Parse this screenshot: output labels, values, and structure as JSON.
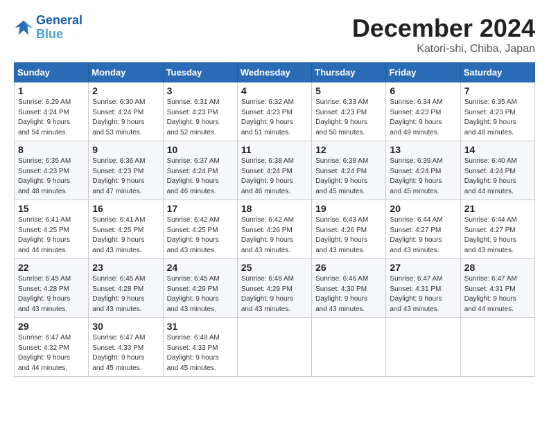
{
  "header": {
    "logo_line1": "General",
    "logo_line2": "Blue",
    "month_year": "December 2024",
    "location": "Katori-shi, Chiba, Japan"
  },
  "weekdays": [
    "Sunday",
    "Monday",
    "Tuesday",
    "Wednesday",
    "Thursday",
    "Friday",
    "Saturday"
  ],
  "weeks": [
    [
      {
        "day": "1",
        "info": "Sunrise: 6:29 AM\nSunset: 4:24 PM\nDaylight: 9 hours\nand 54 minutes."
      },
      {
        "day": "2",
        "info": "Sunrise: 6:30 AM\nSunset: 4:24 PM\nDaylight: 9 hours\nand 53 minutes."
      },
      {
        "day": "3",
        "info": "Sunrise: 6:31 AM\nSunset: 4:23 PM\nDaylight: 9 hours\nand 52 minutes."
      },
      {
        "day": "4",
        "info": "Sunrise: 6:32 AM\nSunset: 4:23 PM\nDaylight: 9 hours\nand 51 minutes."
      },
      {
        "day": "5",
        "info": "Sunrise: 6:33 AM\nSunset: 4:23 PM\nDaylight: 9 hours\nand 50 minutes."
      },
      {
        "day": "6",
        "info": "Sunrise: 6:34 AM\nSunset: 4:23 PM\nDaylight: 9 hours\nand 49 minutes."
      },
      {
        "day": "7",
        "info": "Sunrise: 6:35 AM\nSunset: 4:23 PM\nDaylight: 9 hours\nand 48 minutes."
      }
    ],
    [
      {
        "day": "8",
        "info": "Sunrise: 6:35 AM\nSunset: 4:23 PM\nDaylight: 9 hours\nand 48 minutes."
      },
      {
        "day": "9",
        "info": "Sunrise: 6:36 AM\nSunset: 4:23 PM\nDaylight: 9 hours\nand 47 minutes."
      },
      {
        "day": "10",
        "info": "Sunrise: 6:37 AM\nSunset: 4:24 PM\nDaylight: 9 hours\nand 46 minutes."
      },
      {
        "day": "11",
        "info": "Sunrise: 6:38 AM\nSunset: 4:24 PM\nDaylight: 9 hours\nand 46 minutes."
      },
      {
        "day": "12",
        "info": "Sunrise: 6:38 AM\nSunset: 4:24 PM\nDaylight: 9 hours\nand 45 minutes."
      },
      {
        "day": "13",
        "info": "Sunrise: 6:39 AM\nSunset: 4:24 PM\nDaylight: 9 hours\nand 45 minutes."
      },
      {
        "day": "14",
        "info": "Sunrise: 6:40 AM\nSunset: 4:24 PM\nDaylight: 9 hours\nand 44 minutes."
      }
    ],
    [
      {
        "day": "15",
        "info": "Sunrise: 6:41 AM\nSunset: 4:25 PM\nDaylight: 9 hours\nand 44 minutes."
      },
      {
        "day": "16",
        "info": "Sunrise: 6:41 AM\nSunset: 4:25 PM\nDaylight: 9 hours\nand 43 minutes."
      },
      {
        "day": "17",
        "info": "Sunrise: 6:42 AM\nSunset: 4:25 PM\nDaylight: 9 hours\nand 43 minutes."
      },
      {
        "day": "18",
        "info": "Sunrise: 6:42 AM\nSunset: 4:26 PM\nDaylight: 9 hours\nand 43 minutes."
      },
      {
        "day": "19",
        "info": "Sunrise: 6:43 AM\nSunset: 4:26 PM\nDaylight: 9 hours\nand 43 minutes."
      },
      {
        "day": "20",
        "info": "Sunrise: 6:44 AM\nSunset: 4:27 PM\nDaylight: 9 hours\nand 43 minutes."
      },
      {
        "day": "21",
        "info": "Sunrise: 6:44 AM\nSunset: 4:27 PM\nDaylight: 9 hours\nand 43 minutes."
      }
    ],
    [
      {
        "day": "22",
        "info": "Sunrise: 6:45 AM\nSunset: 4:28 PM\nDaylight: 9 hours\nand 43 minutes."
      },
      {
        "day": "23",
        "info": "Sunrise: 6:45 AM\nSunset: 4:28 PM\nDaylight: 9 hours\nand 43 minutes."
      },
      {
        "day": "24",
        "info": "Sunrise: 6:45 AM\nSunset: 4:29 PM\nDaylight: 9 hours\nand 43 minutes."
      },
      {
        "day": "25",
        "info": "Sunrise: 6:46 AM\nSunset: 4:29 PM\nDaylight: 9 hours\nand 43 minutes."
      },
      {
        "day": "26",
        "info": "Sunrise: 6:46 AM\nSunset: 4:30 PM\nDaylight: 9 hours\nand 43 minutes."
      },
      {
        "day": "27",
        "info": "Sunrise: 6:47 AM\nSunset: 4:31 PM\nDaylight: 9 hours\nand 43 minutes."
      },
      {
        "day": "28",
        "info": "Sunrise: 6:47 AM\nSunset: 4:31 PM\nDaylight: 9 hours\nand 44 minutes."
      }
    ],
    [
      {
        "day": "29",
        "info": "Sunrise: 6:47 AM\nSunset: 4:32 PM\nDaylight: 9 hours\nand 44 minutes."
      },
      {
        "day": "30",
        "info": "Sunrise: 6:47 AM\nSunset: 4:33 PM\nDaylight: 9 hours\nand 45 minutes."
      },
      {
        "day": "31",
        "info": "Sunrise: 6:48 AM\nSunset: 4:33 PM\nDaylight: 9 hours\nand 45 minutes."
      },
      null,
      null,
      null,
      null
    ]
  ]
}
